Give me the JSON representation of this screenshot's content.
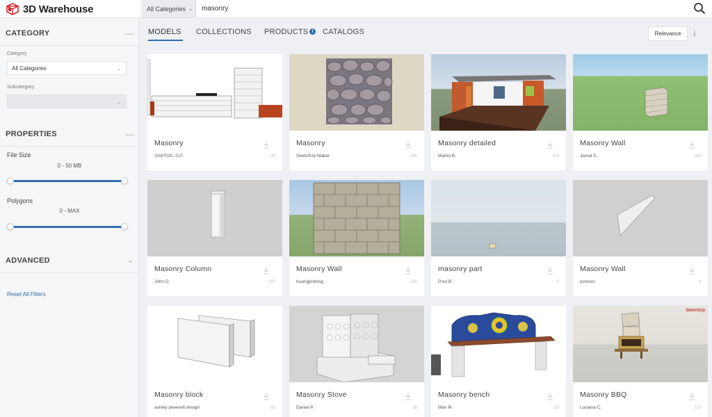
{
  "header": {
    "logo_text": "3D Warehouse",
    "category_select": "All Categories",
    "search_value": "masonry"
  },
  "sidebar": {
    "category_title": "CATEGORY",
    "category_label": "Category",
    "category_value": "All Categories",
    "subcategory_label": "Subcategory",
    "subcategory_value": "",
    "properties_title": "PROPERTIES",
    "file_size_label": "File Size",
    "file_size_range": "0 - 50 MB",
    "polygons_label": "Polygons",
    "polygons_range": "0 - MAX",
    "advanced_title": "ADVANCED",
    "reset_label": "Reset All Filters"
  },
  "tabs": [
    {
      "label": "MODELS"
    },
    {
      "label": "COLLECTIONS"
    },
    {
      "label": "PRODUCTS"
    },
    {
      "label": "CATALOGS"
    }
  ],
  "sort": {
    "label": "Relevance"
  },
  "cards": [
    {
      "title": "Masonry",
      "author": "SANTOS, G.F.",
      "count": "44"
    },
    {
      "title": "Masonry",
      "author": "SketchUp Maker",
      "count": "295"
    },
    {
      "title": "Masonry detailed",
      "author": "Marko B.",
      "count": "103"
    },
    {
      "title": "Masonry Wall",
      "author": "Jamal S.",
      "count": "182"
    },
    {
      "title": "Masonry Column",
      "author": "John D.",
      "count": "197"
    },
    {
      "title": "Masonry Wall",
      "author": "huangjindong",
      "count": "329"
    },
    {
      "title": "masonry part",
      "author": "Poul B.",
      "count": "0"
    },
    {
      "title": "Masonry Wall",
      "author": "pcmoor",
      "count": "4"
    },
    {
      "title": "Masonry block",
      "author": "ashley peverett design",
      "count": "51"
    },
    {
      "title": "Masonry Stove",
      "author": "Daniel P.",
      "count": "16"
    },
    {
      "title": "Masonry bench",
      "author": "Max M.",
      "count": "23"
    },
    {
      "title": "Masonry BBQ",
      "author": "Luciana C.",
      "count": "722"
    }
  ],
  "badge_text": "SketchUp",
  "colors": {
    "accent": "#2f6db2",
    "sidebar_bg": "#f5f6f8",
    "page_bg": "#eef0f3"
  }
}
